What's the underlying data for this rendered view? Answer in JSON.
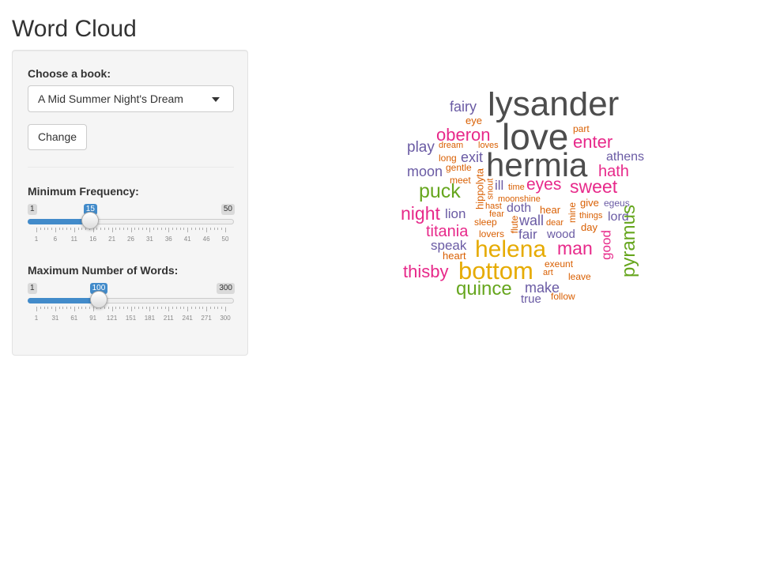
{
  "app": {
    "title": "Word Cloud"
  },
  "controls": {
    "book": {
      "label": "Choose a book:",
      "value": "A Mid Summer Night's Dream"
    },
    "change_button": "Change",
    "min_freq": {
      "label": "Minimum Frequency:",
      "min": 1,
      "max": 50,
      "value": 15,
      "ticks": [
        "1",
        "6",
        "11",
        "16",
        "21",
        "26",
        "31",
        "36",
        "41",
        "46",
        "50"
      ]
    },
    "max_words": {
      "label": "Maximum Number of Words:",
      "min": 1,
      "max": 300,
      "value": 100,
      "ticks": [
        "1",
        "31",
        "61",
        "91",
        "121",
        "151",
        "181",
        "211",
        "241",
        "271",
        "300"
      ]
    }
  },
  "colors": {
    "grey": "#4d4d4d",
    "purple": "#6a5ba4",
    "orange": "#d95f02",
    "magenta": "#e7298a",
    "green": "#66a61e",
    "gold": "#e6ab02",
    "accent": "#428bca"
  },
  "cloud": {
    "words": [
      {
        "text": "lysander",
        "color": "grey",
        "rot": 0
      },
      {
        "text": "love",
        "color": "grey",
        "rot": 0
      },
      {
        "text": "hermia",
        "color": "grey",
        "rot": 0
      },
      {
        "text": "fairy",
        "color": "purple",
        "rot": 0
      },
      {
        "text": "eye",
        "color": "orange",
        "rot": 0
      },
      {
        "text": "part",
        "color": "orange",
        "rot": 0
      },
      {
        "text": "oberon",
        "color": "magenta",
        "rot": 0
      },
      {
        "text": "enter",
        "color": "magenta",
        "rot": 0
      },
      {
        "text": "play",
        "color": "purple",
        "rot": 0
      },
      {
        "text": "dream",
        "color": "orange",
        "rot": 0
      },
      {
        "text": "loves",
        "color": "orange",
        "rot": 0
      },
      {
        "text": "long",
        "color": "orange",
        "rot": 0
      },
      {
        "text": "exit",
        "color": "purple",
        "rot": 0
      },
      {
        "text": "athens",
        "color": "purple",
        "rot": 0
      },
      {
        "text": "moon",
        "color": "purple",
        "rot": 0
      },
      {
        "text": "gentle",
        "color": "orange",
        "rot": 0
      },
      {
        "text": "hath",
        "color": "magenta",
        "rot": 0
      },
      {
        "text": "meet",
        "color": "orange",
        "rot": 0
      },
      {
        "text": "ill",
        "color": "purple",
        "rot": 0
      },
      {
        "text": "time",
        "color": "orange",
        "rot": 0
      },
      {
        "text": "eyes",
        "color": "magenta",
        "rot": 0
      },
      {
        "text": "sweet",
        "color": "magenta",
        "rot": 0
      },
      {
        "text": "puck",
        "color": "green",
        "rot": 0
      },
      {
        "text": "hippolyta",
        "color": "orange",
        "rot": 90
      },
      {
        "text": "snout",
        "color": "orange",
        "rot": 90
      },
      {
        "text": "moonshine",
        "color": "orange",
        "rot": 0
      },
      {
        "text": "give",
        "color": "orange",
        "rot": 0
      },
      {
        "text": "egeus",
        "color": "purple",
        "rot": 0
      },
      {
        "text": "night",
        "color": "magenta",
        "rot": 0
      },
      {
        "text": "lion",
        "color": "purple",
        "rot": 0
      },
      {
        "text": "hast",
        "color": "orange",
        "rot": 0
      },
      {
        "text": "doth",
        "color": "purple",
        "rot": 0
      },
      {
        "text": "hear",
        "color": "orange",
        "rot": 0
      },
      {
        "text": "mine",
        "color": "orange",
        "rot": 90
      },
      {
        "text": "things",
        "color": "orange",
        "rot": 0
      },
      {
        "text": "lord",
        "color": "purple",
        "rot": 0
      },
      {
        "text": "fear",
        "color": "orange",
        "rot": 0
      },
      {
        "text": "sleep",
        "color": "orange",
        "rot": 0
      },
      {
        "text": "wall",
        "color": "purple",
        "rot": 0
      },
      {
        "text": "dear",
        "color": "orange",
        "rot": 0
      },
      {
        "text": "day",
        "color": "orange",
        "rot": 0
      },
      {
        "text": "titania",
        "color": "magenta",
        "rot": 0
      },
      {
        "text": "lovers",
        "color": "orange",
        "rot": 0
      },
      {
        "text": "flute",
        "color": "orange",
        "rot": 90
      },
      {
        "text": "fair",
        "color": "purple",
        "rot": 0
      },
      {
        "text": "wood",
        "color": "purple",
        "rot": 0
      },
      {
        "text": "good",
        "color": "magenta",
        "rot": 90
      },
      {
        "text": "pyramus",
        "color": "green",
        "rot": 90
      },
      {
        "text": "speak",
        "color": "purple",
        "rot": 0
      },
      {
        "text": "helena",
        "color": "gold",
        "rot": 0
      },
      {
        "text": "man",
        "color": "magenta",
        "rot": 0
      },
      {
        "text": "heart",
        "color": "orange",
        "rot": 0
      },
      {
        "text": "exeunt",
        "color": "orange",
        "rot": 0
      },
      {
        "text": "thisby",
        "color": "magenta",
        "rot": 0
      },
      {
        "text": "bottom",
        "color": "gold",
        "rot": 0
      },
      {
        "text": "art",
        "color": "orange",
        "rot": 0
      },
      {
        "text": "leave",
        "color": "orange",
        "rot": 0
      },
      {
        "text": "quince",
        "color": "green",
        "rot": 0
      },
      {
        "text": "make",
        "color": "purple",
        "rot": 0
      },
      {
        "text": "true",
        "color": "purple",
        "rot": 0
      },
      {
        "text": "follow",
        "color": "orange",
        "rot": 0
      }
    ]
  }
}
